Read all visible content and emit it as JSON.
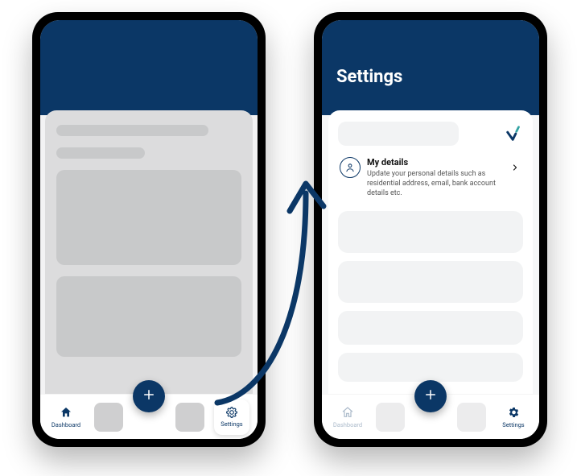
{
  "colors": {
    "brand": "#0b3766",
    "accent_teal": "#33a3a3"
  },
  "left_phone": {
    "tabbar": {
      "dashboard_label": "Dashboard",
      "settings_label": "Settings",
      "fab_label": "+"
    }
  },
  "right_phone": {
    "header_title": "Settings",
    "brand_mark": "v-check-logo",
    "item": {
      "title": "My details",
      "description": "Update your personal details such as residential address, email, bank account details etc."
    },
    "tabbar": {
      "dashboard_label": "Dashboard",
      "settings_label": "Settings",
      "fab_label": "+"
    }
  }
}
